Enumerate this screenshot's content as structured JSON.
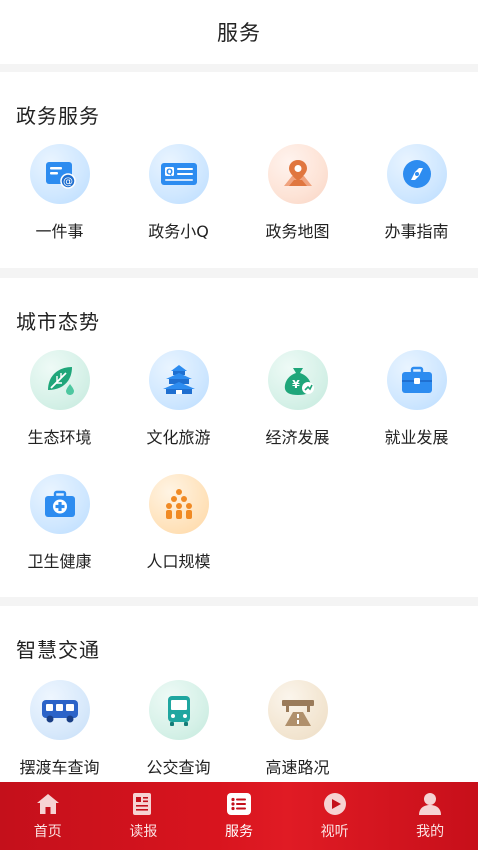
{
  "header": {
    "title": "服务"
  },
  "sections": [
    {
      "title": "政务服务",
      "items": [
        {
          "label": "一件事",
          "icon": "email-doc-icon"
        },
        {
          "label": "政务小Q",
          "icon": "q-card-icon"
        },
        {
          "label": "政务地图",
          "icon": "map-pin-icon"
        },
        {
          "label": "办事指南",
          "icon": "compass-icon"
        }
      ]
    },
    {
      "title": "城市态势",
      "items": [
        {
          "label": "生态环境",
          "icon": "leaf-drop-icon"
        },
        {
          "label": "文化旅游",
          "icon": "temple-icon"
        },
        {
          "label": "经济发展",
          "icon": "money-bag-icon"
        },
        {
          "label": "就业发展",
          "icon": "briefcase-icon"
        },
        {
          "label": "卫生健康",
          "icon": "medical-kit-icon"
        },
        {
          "label": "人口规模",
          "icon": "people-icon"
        }
      ]
    },
    {
      "title": "智慧交通",
      "items": [
        {
          "label": "摆渡车查询",
          "icon": "shuttle-bus-icon"
        },
        {
          "label": "公交查询",
          "icon": "bus-icon"
        },
        {
          "label": "高速路况",
          "icon": "highway-icon"
        }
      ]
    }
  ],
  "tabbar": {
    "items": [
      {
        "label": "首页",
        "icon": "home-icon"
      },
      {
        "label": "读报",
        "icon": "newspaper-icon"
      },
      {
        "label": "服务",
        "icon": "list-icon",
        "active": true
      },
      {
        "label": "视听",
        "icon": "play-icon"
      },
      {
        "label": "我的",
        "icon": "user-icon"
      }
    ]
  },
  "colors": {
    "tabbar": "#d8141e",
    "icon_blue": "#2d8cf0",
    "icon_orange": "#e0763f",
    "icon_green": "#1fa67a"
  }
}
